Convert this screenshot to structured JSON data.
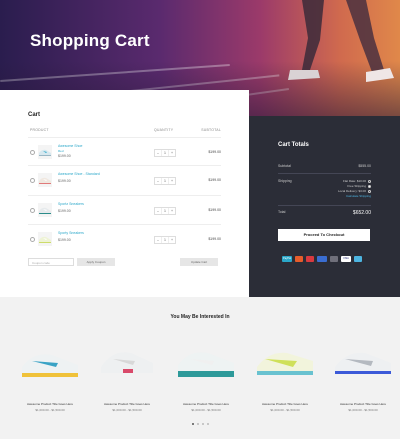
{
  "hero": {
    "title": "Shopping Cart"
  },
  "cart": {
    "title": "Cart",
    "columns": {
      "product": "Product",
      "quantity": "Quantity",
      "subtotal": "Subtotal"
    },
    "items": [
      {
        "name": "Awesome Shoe",
        "attr": "Red",
        "price": "$199.00",
        "qty": "1",
        "subtotal": "$199.00",
        "colors": [
          "#d7e8ef",
          "#9ab6c4",
          "#2aa7c9"
        ]
      },
      {
        "name": "Awesome Shoe - Standard",
        "attr": "",
        "price": "$199.00",
        "qty": "1",
        "subtotal": "$199.00",
        "colors": [
          "#f0e8e0",
          "#e07a7a",
          "#ffffff"
        ]
      },
      {
        "name": "Sportz Sneakers",
        "attr": "",
        "price": "$199.00",
        "qty": "1",
        "subtotal": "$199.00",
        "colors": [
          "#e6eaec",
          "#2b8c8a",
          "#ffffff"
        ]
      },
      {
        "name": "Sporty Sneakers",
        "attr": "",
        "price": "$199.00",
        "qty": "1",
        "subtotal": "$199.00",
        "colors": [
          "#eef3d5",
          "#cddc6a",
          "#ffffff"
        ]
      }
    ],
    "coupon_placeholder": "Coupon code",
    "apply_coupon": "Apply Coupon",
    "update_cart": "Update Cart"
  },
  "totals": {
    "title": "Cart Totals",
    "subtotal_label": "Subtotal",
    "subtotal_value": "$555.00",
    "shipping_label": "Shipping",
    "shipping_options": [
      "Flat Rate: $10.00",
      "Free Shipping",
      "Local Delivery: $3.00"
    ],
    "calculate": "Calculate Shipping",
    "total_label": "Total",
    "total_value": "$652.00",
    "checkout": "Proceed To Checkout",
    "payments": [
      {
        "label": "PayPal",
        "color": "#2aa7c9"
      },
      {
        "label": "MC",
        "color": "#e65c2b"
      },
      {
        "label": "MC",
        "color": "#d9393f"
      },
      {
        "label": "Maestro",
        "color": "#3a6dd1"
      },
      {
        "label": "Amex",
        "color": "#6f6f7a"
      },
      {
        "label": "VISA",
        "color": "#ffffff"
      },
      {
        "label": "Card",
        "color": "#4db4e0"
      }
    ]
  },
  "related": {
    "title": "You May Be Interested In",
    "products": [
      {
        "title": "Awesome Product Title Goes Here",
        "price": "$1,000.00 - $1,500.00",
        "colors": [
          "#eef2f3",
          "#3aa3c5",
          "#f0c23a"
        ]
      },
      {
        "title": "Awesome Product Title Goes Here",
        "price": "$1,000.00 - $1,500.00",
        "colors": [
          "#eef0f1",
          "#d8d8d8",
          "#d94a6a"
        ]
      },
      {
        "title": "Awesome Product Title Goes Here",
        "price": "$1,000.00 - $1,500.00",
        "colors": [
          "#eef3f3",
          "#2e9a9a",
          "#f0f0f0"
        ]
      },
      {
        "title": "Awesome Product Title Goes Here",
        "price": "$1,000.00 - $1,500.00",
        "colors": [
          "#f2f4dc",
          "#cfe05a",
          "#69c2d0"
        ]
      },
      {
        "title": "Awesome Product Title Goes Here",
        "price": "$1,000.00 - $1,500.00",
        "colors": [
          "#eef0f2",
          "#b4b9c0",
          "#3c5ad8"
        ]
      }
    ]
  }
}
